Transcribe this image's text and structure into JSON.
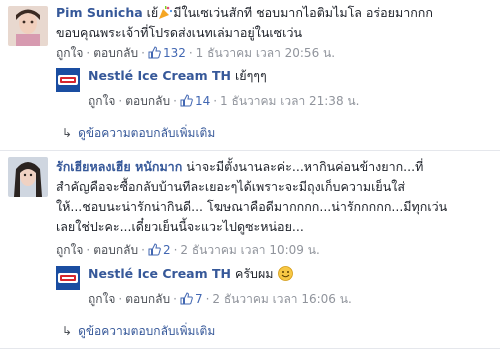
{
  "comments": [
    {
      "author": "Pim Sunicha",
      "text_line1": "เย้",
      "text_line1b": "มีในเซเว่นสักที ชอบมากไอติมไมโล อร่อยมากกก",
      "text_line2": "ขอบคุณพระเจ้าที่โปรดส่งเนทเล่มาอยู่ในเซเว่น",
      "like_label": "ถูกใจ",
      "reply_label": "ตอบกลับ",
      "like_count": "132",
      "date": "1 ธันวาคม เวลา 20:56 น.",
      "reply": {
        "author": "Nestlé Ice Cream TH",
        "text": "เย้ๆๆๆ",
        "like_label": "ถูกใจ",
        "reply_label": "ตอบกลับ",
        "like_count": "14",
        "date": "1 ธันวาคม เวลา 21:38 น."
      },
      "more_replies": "ดูข้อความตอบกลับเพิ่มเติม"
    },
    {
      "author": "รักเฮียหลงเฮีย หนักมาก",
      "text_line1": "น่าจะมีตั้งนานละค่ะ...หากินค่อนข้างยาก...ที่",
      "text_line2": "สำคัญคือจะซื้อกลับบ้านทีละเยอะๆได้เพราะจะมีถุงเก็บความเย็นใส่",
      "text_line3": "ให้...ชอบนะน่ารักน่ากินดี... โฆษณาคือดีมากกกก...น่ารักกกกก...มีทุกเว่น",
      "text_line4": "เลยใช่ปะคะ...เดี๋ยวเย็นนี้จะแวะไปดูซะหน่อย...",
      "like_label": "ถูกใจ",
      "reply_label": "ตอบกลับ",
      "like_count": "2",
      "date": "2 ธันวาคม เวลา 10:09 น.",
      "reply": {
        "author": "Nestlé Ice Cream TH",
        "text": "ครับผม",
        "like_label": "ถูกใจ",
        "reply_label": "ตอบกลับ",
        "like_count": "7",
        "date": "2 ธันวาคม เวลา 16:06 น."
      },
      "more_replies": "ดูข้อความตอบกลับเพิ่มเติม"
    }
  ],
  "colors": {
    "author": "#365899",
    "meta": "#90949c",
    "like_accent": "#4267b2"
  }
}
